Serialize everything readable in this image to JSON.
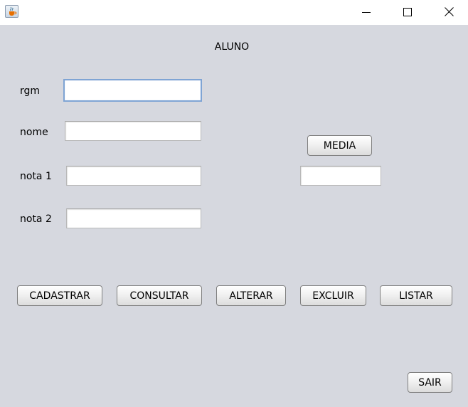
{
  "window": {
    "title_bar_icon": "java-cup-icon",
    "controls": {
      "minimize": "minimize-icon",
      "maximize": "maximize-icon",
      "close": "close-icon"
    }
  },
  "form": {
    "title": "ALUNO",
    "fields": {
      "rgm": {
        "label": "rgm",
        "value": ""
      },
      "nome": {
        "label": "nome",
        "value": ""
      },
      "nota1": {
        "label": "nota 1",
        "value": ""
      },
      "nota2": {
        "label": "nota 2",
        "value": ""
      },
      "media": {
        "value": ""
      }
    },
    "buttons": {
      "media": "MEDIA",
      "cadastrar": "CADASTRAR",
      "consultar": "CONSULTAR",
      "alterar": "ALTERAR",
      "excluir": "EXCLUIR",
      "listar": "LISTAR",
      "sair": "SAIR"
    }
  }
}
